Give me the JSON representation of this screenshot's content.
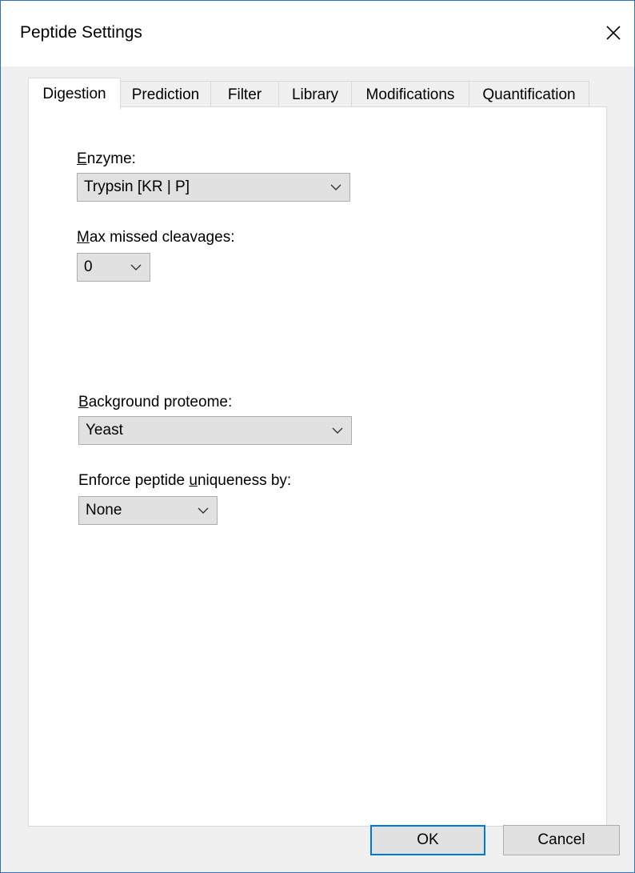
{
  "window": {
    "title": "Peptide Settings"
  },
  "tabs": [
    {
      "label": "Digestion",
      "active": true
    },
    {
      "label": "Prediction",
      "active": false
    },
    {
      "label": "Filter",
      "active": false
    },
    {
      "label": "Library",
      "active": false
    },
    {
      "label": "Modifications",
      "active": false
    },
    {
      "label": "Quantification",
      "active": false
    }
  ],
  "digestion": {
    "enzyme": {
      "label_prefix": "",
      "label_mnemonic": "E",
      "label_rest": "nzyme:",
      "value": "Trypsin [KR | P]"
    },
    "max_missed": {
      "label_mnemonic": "M",
      "label_rest": "ax missed cleavages:",
      "value": "0"
    },
    "background": {
      "label_mnemonic": "B",
      "label_rest": "ackground proteome:",
      "value": "Yeast"
    },
    "uniqueness": {
      "label_prefix": "Enforce peptide ",
      "label_mnemonic": "u",
      "label_rest": "niqueness by:",
      "value": "None"
    }
  },
  "buttons": {
    "ok": "OK",
    "cancel": "Cancel"
  },
  "icons": {
    "close": "close-icon",
    "dropdown": "chevron-down-icon"
  },
  "colors": {
    "window_border": "#2f6fc4",
    "default_button_border": "#0078d7",
    "face": "#f0f0f0"
  }
}
